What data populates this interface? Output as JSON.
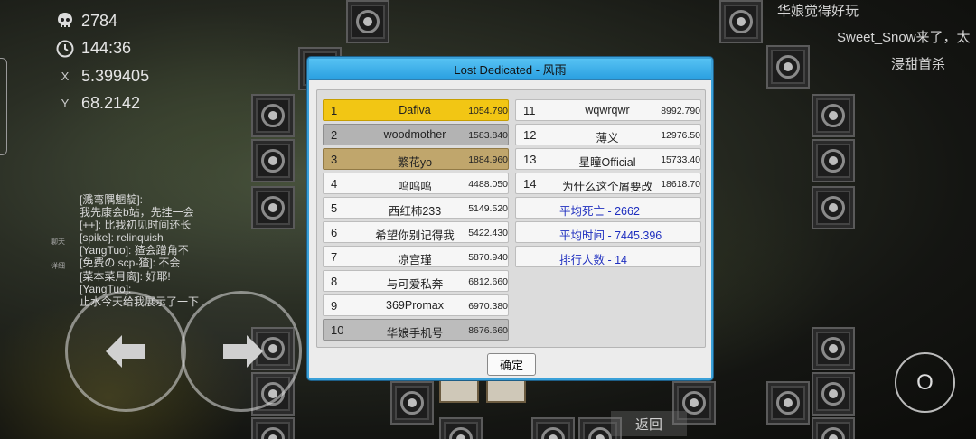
{
  "hud": {
    "deaths": "2784",
    "time": "144:36",
    "x_label": "X",
    "x_value": "5.399405",
    "y_label": "Y",
    "y_value": "68.2142"
  },
  "chat": {
    "lines": [
      "[溅弯隅魍靛]:",
      "我先康会b站，先挂一会",
      "[++]: 比我初见时间还长",
      "[spike]: relinquish",
      "[YangTuo]: 猹会蹭角不",
      "[免费の scp-猹]: 不会",
      "[菜本菜月离]: 好耶!",
      "[YangTuo]:",
      "止水今天给我展示了一下"
    ],
    "tab_chat": "聊天",
    "tab_detail": "详细"
  },
  "messages": {
    "msg1": "华娘觉得好玩",
    "msg2": "Sweet_Snow来了，太",
    "msg3": "浸甜首杀"
  },
  "dialog": {
    "title": "Lost Dedicated - 风雨",
    "ok_label": "确定",
    "left_rows": [
      {
        "rank": "1",
        "name": "Dafiva",
        "time": "1054.790"
      },
      {
        "rank": "2",
        "name": "woodmother",
        "time": "1583.840"
      },
      {
        "rank": "3",
        "name": "繁花yo",
        "time": "1884.960"
      },
      {
        "rank": "4",
        "name": "呜呜呜",
        "time": "4488.050"
      },
      {
        "rank": "5",
        "name": "西红柿233",
        "time": "5149.520"
      },
      {
        "rank": "6",
        "name": "希望你别记得我",
        "time": "5422.430"
      },
      {
        "rank": "7",
        "name": "凉宫瑾",
        "time": "5870.940"
      },
      {
        "rank": "8",
        "name": "与可爱私奔",
        "time": "6812.660"
      },
      {
        "rank": "9",
        "name": "369Promax",
        "time": "6970.380"
      },
      {
        "rank": "10",
        "name": "华娘手机号",
        "time": "8676.660"
      }
    ],
    "right_rows": [
      {
        "rank": "11",
        "name": "wqwrqwr",
        "time": "8992.790"
      },
      {
        "rank": "12",
        "name": "薄义",
        "time": "12976.50"
      },
      {
        "rank": "13",
        "name": "星瞳Official",
        "time": "15733.40"
      },
      {
        "rank": "14",
        "name": "为什么这个屑要改",
        "time": "18618.70"
      }
    ],
    "stats": {
      "avg_deaths": "平均死亡 - 2662",
      "avg_time": "平均时间 - 7445.396",
      "players": "排行人数 - 14"
    }
  },
  "controls": {
    "o_label": "O",
    "back_label": "返回"
  },
  "colors": {
    "title_bar": "#2a9fe0",
    "gold": "#f2c614",
    "silver": "#b3b3b3",
    "bronze": "#c0a66c",
    "stat_text": "#1f2fbf"
  }
}
